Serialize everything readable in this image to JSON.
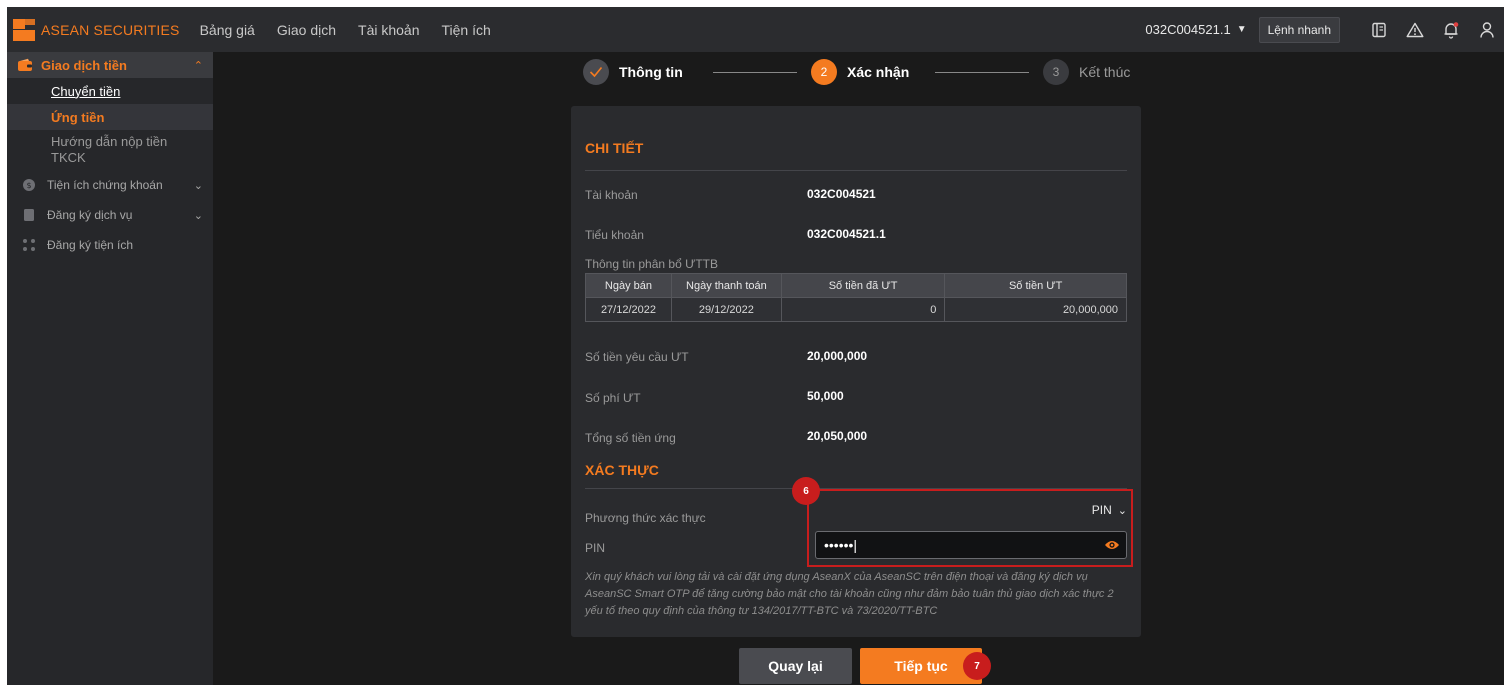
{
  "brand": {
    "name": "ASEAN SECURITIES",
    "accent": "#f47b20"
  },
  "nav": [
    "Bảng giá",
    "Giao dịch",
    "Tài khoản",
    "Tiện ích"
  ],
  "header_right": {
    "account": "032C004521.1",
    "quick_order": "Lệnh nhanh",
    "icons": [
      "book-icon",
      "warning-icon",
      "bell-icon",
      "user-icon"
    ]
  },
  "sidebar": {
    "section": "Giao dịch tiền",
    "sub_items": [
      "Chuyển tiền",
      "Ứng tiền",
      "Hướng dẫn nộp tiền TKCK"
    ],
    "groups": [
      "Tiện ích chứng khoán",
      "Đăng ký dịch vụ",
      "Đăng ký tiện ích"
    ]
  },
  "stepper": [
    {
      "num": "",
      "label": "Thông tin"
    },
    {
      "num": "2",
      "label": "Xác nhận"
    },
    {
      "num": "3",
      "label": "Kết thúc"
    }
  ],
  "details": {
    "title": "CHI TIẾT",
    "account_label": "Tài khoản",
    "account_value": "032C004521",
    "subaccount_label": "Tiểu khoản",
    "subaccount_value": "032C004521.1",
    "alloc_label": "Thông tin phân bổ ƯTTB",
    "alloc_headers": [
      "Ngày bán",
      "Ngày thanh toán",
      "Số tiền đã ƯT",
      "Số tiền ƯT"
    ],
    "alloc_rows": [
      [
        "27/12/2022",
        "29/12/2022",
        "0",
        "20,000,000"
      ]
    ],
    "request_label": "Số tiền yêu cầu ƯT",
    "request_value": "20,000,000",
    "fee_label": "Số phí ƯT",
    "fee_value": "50,000",
    "total_label": "Tổng số tiền ứng",
    "total_value": "20,050,000"
  },
  "auth": {
    "title": "XÁC THỰC",
    "method_label": "Phương thức xác thực",
    "method_value": "PIN",
    "pin_label": "PIN",
    "pin_value": "••••••",
    "note": "Xin quý khách vui lòng tải và cài đặt ứng dụng AseanX của AseanSC trên điện thoại và đăng ký dịch vụ AseanSC Smart OTP để tăng cường bảo mật cho tài khoản cũng như đảm bảo tuân thủ giao dịch xác thực 2 yếu tố theo quy định của thông tư 134/2017/TT-BTC và 73/2020/TT-BTC"
  },
  "buttons": {
    "back": "Quay lại",
    "next": "Tiếp tục"
  },
  "annotations": {
    "pin_step": "6",
    "next_step": "7",
    "color": "#c81d1d"
  }
}
